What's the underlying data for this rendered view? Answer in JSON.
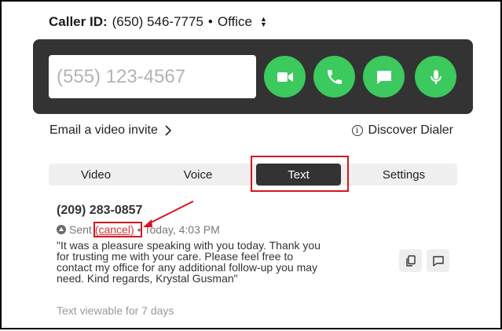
{
  "caller_id": {
    "label": "Caller ID:",
    "number": "(650) 546-7775",
    "separator": "•",
    "line": "Office"
  },
  "dialer": {
    "placeholder": "(555) 123-4567",
    "buttons": [
      "video-call",
      "voice-call",
      "text-message",
      "microphone"
    ],
    "accent_color": "#3cc95e"
  },
  "links": {
    "email_invite": "Email a video invite",
    "discover": "Discover Dialer"
  },
  "tabs": [
    {
      "label": "Video"
    },
    {
      "label": "Voice"
    },
    {
      "label": "Text",
      "active": true
    },
    {
      "label": "Settings"
    }
  ],
  "message": {
    "contact": "(209) 283-0857",
    "status": "Sent",
    "cancel_label": "(cancel)",
    "separator": "•",
    "timestamp": "Today, 4:03 PM",
    "body": "\"It was a pleasure speaking with you today. Thank you for trusting me with your care. Please feel free to contact my office for any additional follow-up you may need. Kind regards, Krystal Gusman\"",
    "footer": "Text viewable for 7 days"
  },
  "annotation_color": "#d9141e"
}
